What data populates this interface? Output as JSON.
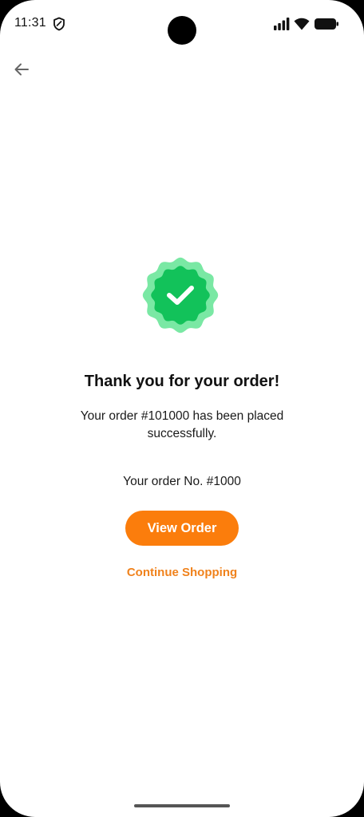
{
  "status_bar": {
    "time": "11:31",
    "icons": [
      "shield-icon",
      "signal-icon",
      "wifi-icon",
      "battery-icon"
    ]
  },
  "header": {
    "back_icon": "arrow-left-icon"
  },
  "confirmation": {
    "badge_icon": "check-badge-icon",
    "title": "Thank you for your order!",
    "message": "Your order #101000 has been placed successfully.",
    "order_number": "Your order No. #1000"
  },
  "actions": {
    "view_order_label": "View Order",
    "continue_label": "Continue Shopping"
  },
  "colors": {
    "accent": "#fb7d0c",
    "link": "#f0821c",
    "success_dark": "#12c25a",
    "success_light": "#7ae8a4"
  }
}
